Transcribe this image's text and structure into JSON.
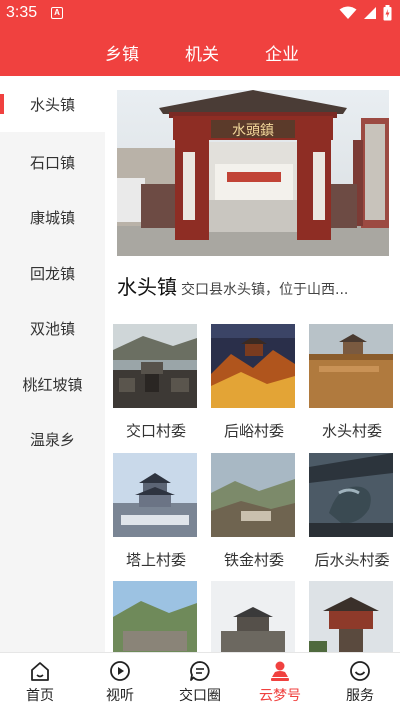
{
  "status_bar": {
    "time": "3:35",
    "notification_letter": "A"
  },
  "category_tabs": [
    "乡镇",
    "机关",
    "企业"
  ],
  "sidebar": {
    "items": [
      "水头镇",
      "石口镇",
      "康城镇",
      "回龙镇",
      "双池镇",
      "桃红坡镇",
      "温泉乡"
    ],
    "active_index": 0
  },
  "hero": {
    "sign_text": "水頭鎮"
  },
  "town": {
    "name": "水头镇",
    "description": "交口县水头镇，位于山西..."
  },
  "villages": [
    "交口村委",
    "后峪村委",
    "水头村委",
    "塔上村委",
    "铁金村委",
    "后水头村委"
  ],
  "bottom_nav": {
    "items": [
      "首页",
      "视听",
      "交口圈",
      "云梦号",
      "服务"
    ],
    "active_index": 3
  },
  "colors": {
    "brand_red": "#f0413f"
  }
}
